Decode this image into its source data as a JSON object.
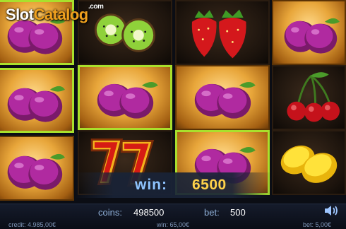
{
  "logo": {
    "part1": "Slot",
    "part2": "Catalog",
    "suffix": ".com"
  },
  "reels": [
    [
      "plum",
      "plum",
      "plum"
    ],
    [
      "kiwi",
      "plum",
      "seven"
    ],
    [
      "strawberry",
      "plum",
      "plum"
    ],
    [
      "plum",
      "cherry",
      "lemon"
    ]
  ],
  "win_banner": {
    "label": "win:",
    "value": "6500"
  },
  "status_bar": {
    "coins_label": "coins:",
    "coins_value": "498500",
    "bet_label": "bet:",
    "bet_value": "500",
    "credit": "credit: 4.985,00€",
    "win": "win: 65,00€",
    "bet_money": "bet: 5,00€"
  },
  "colors": {
    "win_highlight": "#a9e02c",
    "win_value": "#ffd24a",
    "label_blue": "#8fc4ff"
  },
  "icons": [
    "sound-icon"
  ]
}
